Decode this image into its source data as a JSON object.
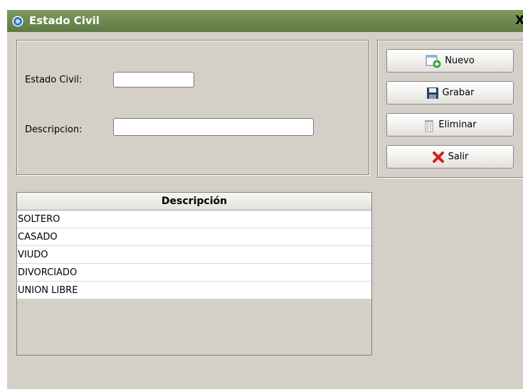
{
  "window": {
    "title": "Estado Civil",
    "close_symbol": "X"
  },
  "form": {
    "estado_civil": {
      "label": "Estado Civil:",
      "value": ""
    },
    "descripcion": {
      "label": "Descripcion:",
      "value": ""
    }
  },
  "buttons": {
    "nuevo": {
      "label": "Nuevo",
      "icon": "add-document-icon"
    },
    "grabar": {
      "label": "Grabar",
      "icon": "floppy-disk-icon"
    },
    "eliminar": {
      "label": "Eliminar",
      "icon": "trash-can-icon"
    },
    "salir": {
      "label": "Salir",
      "icon": "red-x-icon"
    }
  },
  "table": {
    "columns": [
      "Descripción"
    ],
    "rows": [
      "SOLTERO",
      "CASADO",
      "VIUDO",
      "DIVORCIADO",
      "UNION LIBRE"
    ]
  },
  "colors": {
    "titlebar": "#6f8a52",
    "window_bg": "#d4d0c8"
  }
}
